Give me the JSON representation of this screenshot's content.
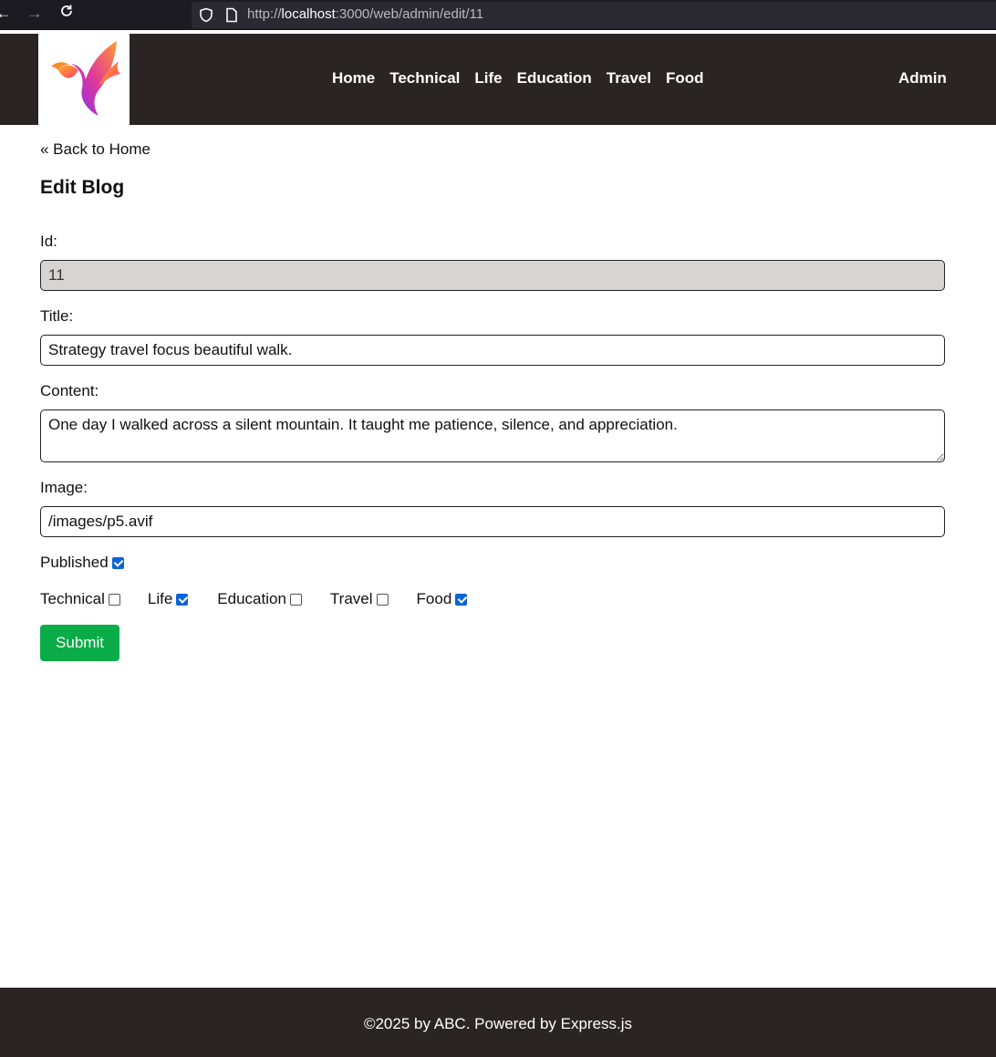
{
  "browser": {
    "url_scheme": "http://",
    "url_host": "localhost",
    "url_rest": ":3000/web/admin/edit/11"
  },
  "header": {
    "logo": "bird-logo",
    "nav": [
      "Home",
      "Technical",
      "Life",
      "Education",
      "Travel",
      "Food"
    ],
    "admin_label": "Admin"
  },
  "page": {
    "back_link": "« Back to Home",
    "title": "Edit Blog"
  },
  "form": {
    "id_label": "Id:",
    "id_value": "11",
    "title_label": "Title:",
    "title_value": "Strategy travel focus beautiful walk.",
    "content_label": "Content:",
    "content_value": "One day I walked across a silent mountain. It taught me patience, silence, and appreciation.",
    "image_label": "Image:",
    "image_value": "/images/p5.avif",
    "published_label": "Published",
    "published": true,
    "categories": [
      {
        "label": "Technical",
        "checked": false
      },
      {
        "label": "Life",
        "checked": true
      },
      {
        "label": "Education",
        "checked": false
      },
      {
        "label": "Travel",
        "checked": false
      },
      {
        "label": "Food",
        "checked": true
      }
    ],
    "submit_label": "Submit"
  },
  "footer": {
    "text": "©2025 by ABC. Powered by Express.js"
  },
  "colors": {
    "header_bg": "#2a2524",
    "submit_bg": "#0aac47",
    "checkbox_on": "#0b63d6",
    "readonly_bg": "#d8d4d1"
  }
}
